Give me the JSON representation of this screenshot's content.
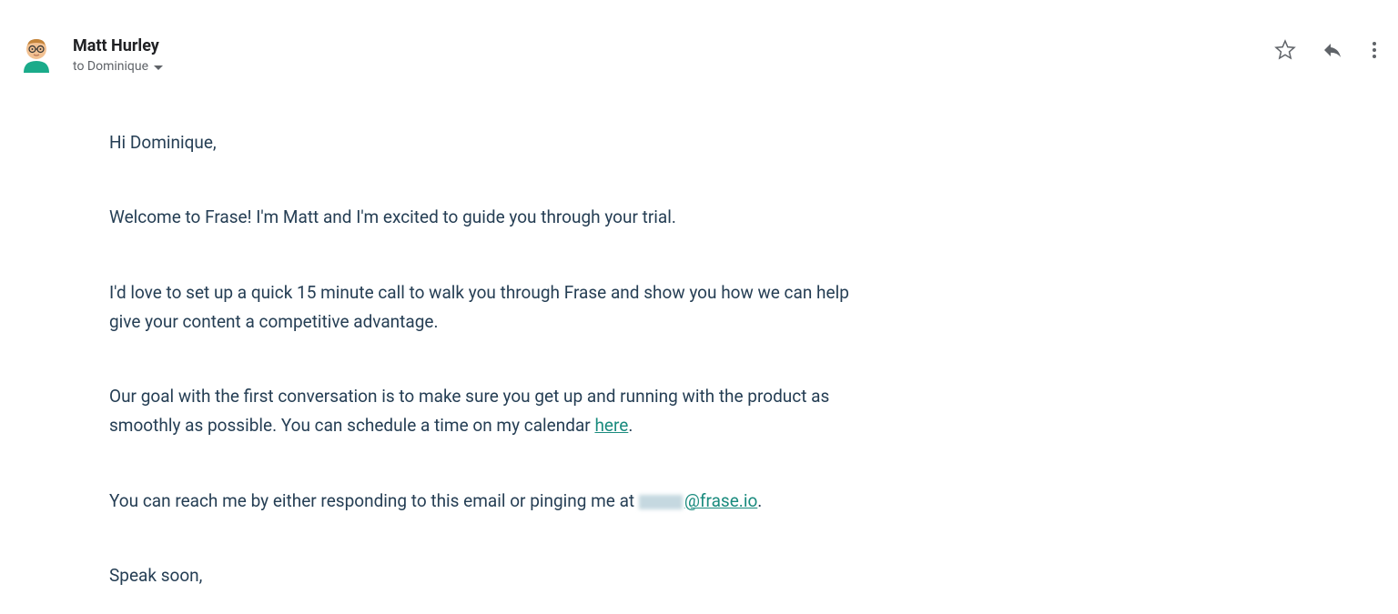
{
  "sender": {
    "name": "Matt Hurley"
  },
  "recipient": {
    "to_prefix": "to ",
    "name": "Dominique"
  },
  "body": {
    "greeting": "Hi Dominique,",
    "p1": "Welcome to Frase! I'm Matt and I'm excited to guide you through your trial.",
    "p2": "I'd love to set up a quick 15 minute call to walk you through Frase and show you how we can help give your content a competitive advantage.",
    "p3_before": "Our goal with the first conversation is to make sure you get up and running with the product as smoothly as possible. You can schedule a time on my calendar ",
    "p3_link": "here",
    "p3_after": ".",
    "p4_before": "You can reach me by either responding to this email or pinging me at ",
    "p4_email_domain": "@frase.io",
    "p4_after": ".",
    "closing": "Speak soon,"
  }
}
